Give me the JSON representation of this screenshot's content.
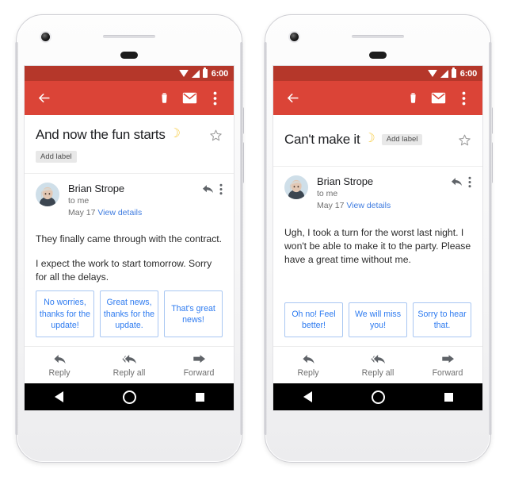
{
  "page": {
    "background": "#ffffff",
    "accent_red": "#db4437",
    "statusbar_red": "#b5372a",
    "link_blue": "#3f7ce0",
    "chip_blue": "#2e7bf0",
    "chip_border": "#a9c7f2"
  },
  "phones": [
    {
      "id": "phone-left",
      "statusbar": {
        "time": "6:00",
        "icons": [
          "wifi-icon",
          "signal-icon",
          "battery-icon"
        ]
      },
      "appbar": {
        "back_label": "back-arrow-icon",
        "actions": [
          "delete-icon",
          "mark-unread-icon",
          "overflow-menu-icon"
        ]
      },
      "subject": {
        "text": "And now the fun starts",
        "emoji": "☽",
        "emoji_name": "crescent-moon-emoji",
        "add_label": "Add label",
        "label_inline": false,
        "starred": false
      },
      "sender": {
        "name": "Brian Strope",
        "recipient": "to me",
        "date": "May 17",
        "details_link": "View details"
      },
      "body": [
        "They finally came through with the contract.",
        "I expect the work to start tomorrow. Sorry for all the delays."
      ],
      "smart_replies": [
        "No worries, thanks for the update!",
        "Great news, thanks for the update.",
        "That's great news!"
      ],
      "reply_bar": [
        {
          "label": "Reply",
          "icon": "reply-icon"
        },
        {
          "label": "Reply all",
          "icon": "reply-all-icon"
        },
        {
          "label": "Forward",
          "icon": "forward-icon"
        }
      ],
      "navbar": [
        "back-triangle-icon",
        "home-circle-icon",
        "recents-square-icon"
      ]
    },
    {
      "id": "phone-right",
      "statusbar": {
        "time": "6:00",
        "icons": [
          "wifi-icon",
          "signal-icon",
          "battery-icon"
        ]
      },
      "appbar": {
        "back_label": "back-arrow-icon",
        "actions": [
          "delete-icon",
          "mark-unread-icon",
          "overflow-menu-icon"
        ]
      },
      "subject": {
        "text": "Can't make it",
        "emoji": "☽",
        "emoji_name": "crescent-moon-emoji",
        "add_label": "Add label",
        "label_inline": true,
        "starred": false
      },
      "sender": {
        "name": "Brian Strope",
        "recipient": "to me",
        "date": "May 17",
        "details_link": "View details"
      },
      "body": [
        "Ugh, I took a turn for the worst last night. I won't be able to make it to the party. Please have a great time without me."
      ],
      "smart_replies": [
        "Oh no! Feel better!",
        "We will miss you!",
        "Sorry to hear that."
      ],
      "reply_bar": [
        {
          "label": "Reply",
          "icon": "reply-icon"
        },
        {
          "label": "Reply all",
          "icon": "reply-all-icon"
        },
        {
          "label": "Forward",
          "icon": "forward-icon"
        }
      ],
      "navbar": [
        "back-triangle-icon",
        "home-circle-icon",
        "recents-square-icon"
      ]
    }
  ]
}
